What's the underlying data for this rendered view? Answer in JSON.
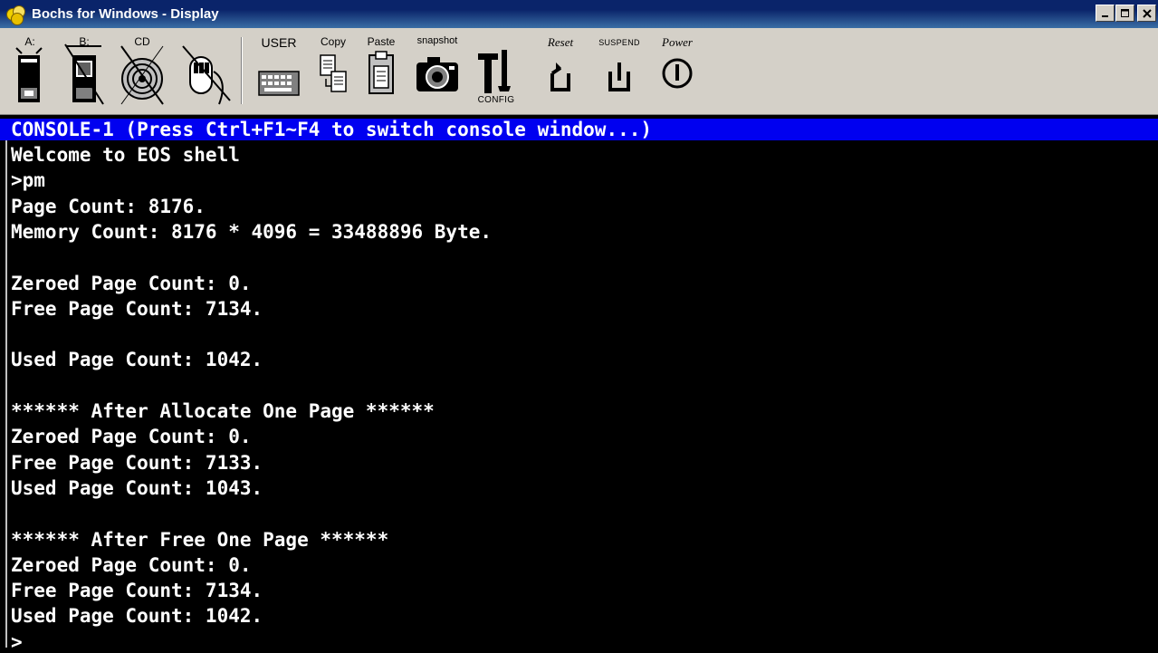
{
  "window": {
    "title": "Bochs for Windows - Display",
    "controls": {
      "minimize": "_",
      "maximize": "□",
      "close": "✕"
    }
  },
  "toolbar": {
    "items": [
      {
        "id": "floppy-a",
        "label": "A:"
      },
      {
        "id": "floppy-b",
        "label": "B:"
      },
      {
        "id": "cdrom",
        "label": "CD"
      },
      {
        "id": "mouse",
        "label": ""
      },
      {
        "id": "user",
        "label": "USER"
      },
      {
        "id": "copy",
        "label": "Copy"
      },
      {
        "id": "paste",
        "label": "Paste"
      },
      {
        "id": "snapshot",
        "label": "snapshot"
      },
      {
        "id": "config",
        "label": "CONFIG"
      },
      {
        "id": "reset",
        "label": "Reset"
      },
      {
        "id": "suspend",
        "label": "SUSPEND"
      },
      {
        "id": "power",
        "label": "Power"
      }
    ]
  },
  "console": {
    "header": "CONSOLE-1 (Press Ctrl+F1~F4 to switch console window...)",
    "lines": [
      "Welcome to EOS shell",
      ">pm",
      "Page Count: 8176.",
      "Memory Count: 8176 * 4096 = 33488896 Byte.",
      "",
      "Zeroed Page Count: 0.",
      "Free Page Count: 7134.",
      "",
      "Used Page Count: 1042.",
      "",
      "****** After Allocate One Page ******",
      "Zeroed Page Count: 0.",
      "Free Page Count: 7133.",
      "Used Page Count: 1043.",
      "",
      "****** After Free One Page ******",
      "Zeroed Page Count: 0.",
      "Free Page Count: 7134.",
      "Used Page Count: 1042.",
      ">"
    ]
  },
  "colors": {
    "titlebar": "#0a246a",
    "toolbar": "#d4d0c8",
    "console_bg": "#000000",
    "console_header_bg": "#0000f0",
    "console_text": "#ffffff"
  }
}
